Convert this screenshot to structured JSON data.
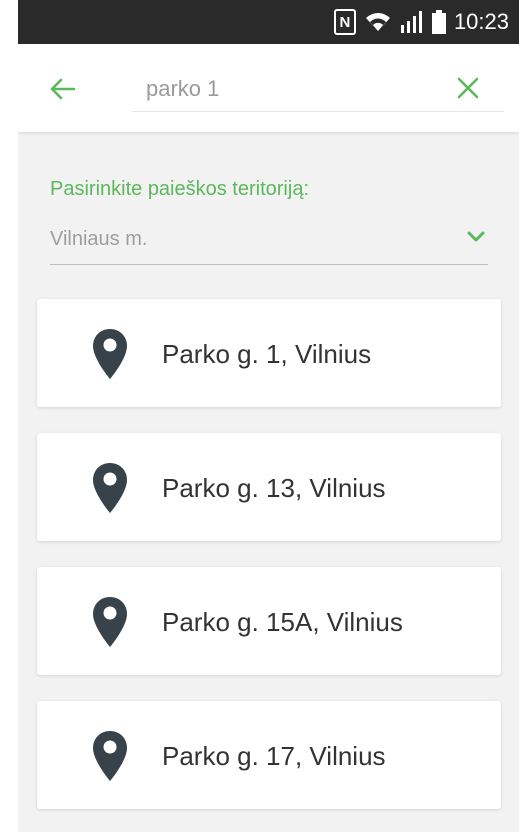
{
  "status_bar": {
    "nfc_icon": "nfc-icon",
    "wifi_icon": "wifi-icon",
    "signal_icon": "signal-icon",
    "battery_icon": "battery-icon",
    "time": "10:23"
  },
  "toolbar": {
    "back_icon": "arrow-left-icon",
    "search_value": "parko 1",
    "clear_icon": "close-icon"
  },
  "territory": {
    "label": "Pasirinkite paieškos teritoriją:",
    "selected": "Vilniaus m.",
    "dropdown_icon": "chevron-down-icon"
  },
  "results": [
    {
      "label": "Parko g. 1,  Vilnius",
      "icon": "location-pin-icon"
    },
    {
      "label": "Parko g. 13,  Vilnius",
      "icon": "location-pin-icon"
    },
    {
      "label": "Parko g. 15A,  Vilnius",
      "icon": "location-pin-icon"
    },
    {
      "label": "Parko g. 17,  Vilnius",
      "icon": "location-pin-icon"
    }
  ],
  "colors": {
    "accent_green": "#5cb85c",
    "status_bar": "#2a2a2a",
    "pin": "#37424a"
  }
}
